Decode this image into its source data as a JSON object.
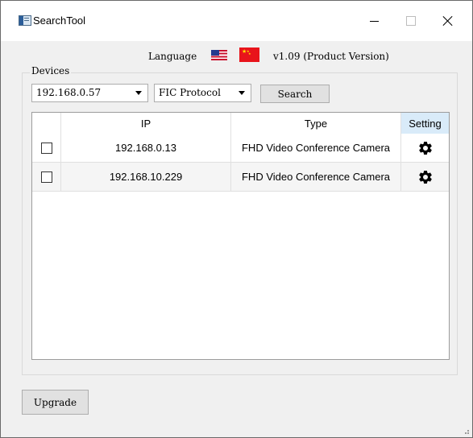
{
  "window": {
    "title": "SearchTool",
    "icons": {
      "app": "app-window-icon",
      "minimize": "minimize-icon",
      "maximize": "maximize-icon",
      "close": "close-icon"
    }
  },
  "header": {
    "language_label": "Language",
    "flags": [
      "us-flag-icon",
      "china-flag-icon"
    ],
    "version": "v1.09  (Product Version)"
  },
  "devices": {
    "group_label": "Devices",
    "ip_select": {
      "value": "192.168.0.57"
    },
    "protocol_select": {
      "value": "FIC Protocol"
    },
    "search_label": "Search"
  },
  "table": {
    "columns": [
      "",
      "IP",
      "Type",
      "Setting"
    ],
    "rows": [
      {
        "checked": false,
        "ip": "192.168.0.13",
        "type": "FHD Video Conference Camera",
        "setting_icon": "gear-icon"
      },
      {
        "checked": false,
        "ip": "192.168.10.229",
        "type": "FHD Video Conference Camera",
        "setting_icon": "gear-icon"
      }
    ]
  },
  "footer": {
    "upgrade_label": "Upgrade"
  },
  "colors": {
    "header_setting_bg": "#d9ebf9",
    "window_bg": "#f0f0f0"
  }
}
